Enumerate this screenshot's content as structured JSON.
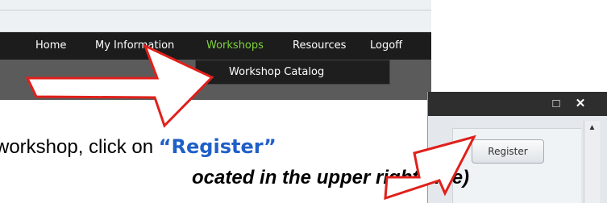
{
  "nav": {
    "items": [
      {
        "label": "Home"
      },
      {
        "label": "My Information"
      },
      {
        "label": "Workshops"
      },
      {
        "label": "Resources"
      },
      {
        "label": "Logoff"
      }
    ],
    "dropdown_item": "Workshop Catalog",
    "active_color": "#7fd23a"
  },
  "window": {
    "maximize_icon": "□",
    "close_icon": "✕",
    "register_label": "Register",
    "scroll_up_icon": "▲"
  },
  "instructions": {
    "line1_prefix": "workshop, click on ",
    "line1_highlight": "“Register”",
    "line2": "ocated in the upper right side)"
  },
  "colors": {
    "arrow_fill": "#ffffff",
    "arrow_stroke": "#e0201b",
    "highlight": "#1f5fc8"
  }
}
